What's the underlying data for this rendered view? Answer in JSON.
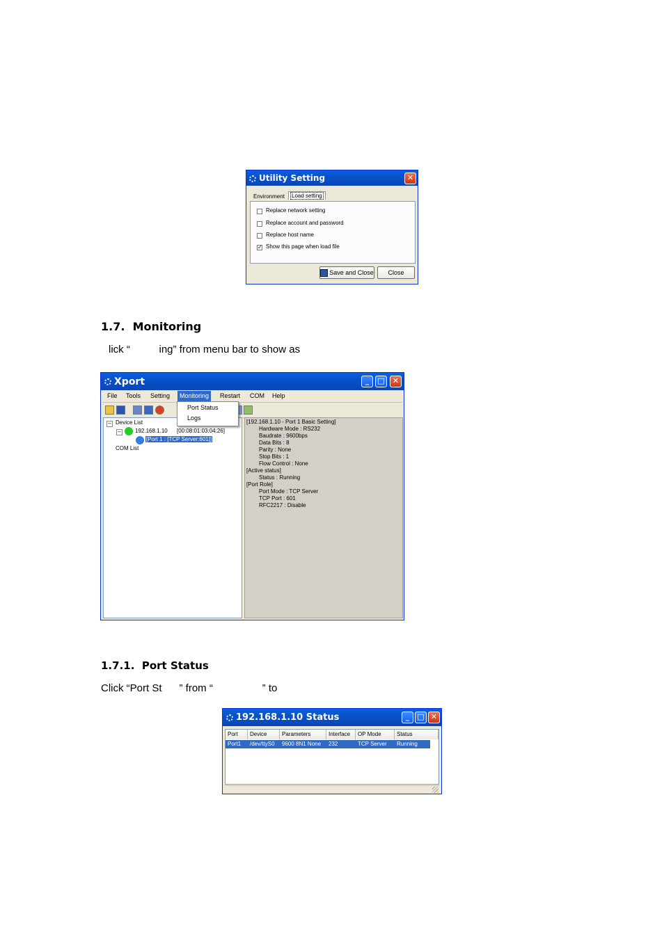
{
  "utility": {
    "title": "Utility Setting",
    "tabs": [
      "Environment",
      "Load setting"
    ],
    "options": [
      {
        "label": "Replace network setting",
        "checked": false
      },
      {
        "label": "Replace account and password",
        "checked": false
      },
      {
        "label": "Replace host name",
        "checked": false
      },
      {
        "label": "Show this page when load file",
        "checked": true
      }
    ],
    "save_label": "Save and Close",
    "close_label": "Close"
  },
  "section_monitoring": {
    "heading": "1.7.  Monitoring",
    "text": "lick “          ing” from menu bar to show as"
  },
  "xport": {
    "title": "Xport",
    "menu": [
      "File",
      "Tools",
      "Setting",
      "Monitoring",
      "Restart",
      "COM",
      "Help"
    ],
    "dropdown": [
      "Port Status",
      "Logs"
    ],
    "tree": {
      "device_list": "Device List",
      "device_ip": "192.168.1.10",
      "device_mac": "[00:08:01:03:04:26]",
      "port": "[Port 1 : [TCP Server:601]]",
      "com_list": "COM List"
    },
    "details": [
      "[192.168.1.10 - Port 1 Basic Setting]",
      "Hardware Mode : RS232",
      "Baudrate : 9600bps",
      "Data Bits : 8",
      "Parity : None",
      "Stop Bits : 1",
      "Flow Control : None",
      "[Active status]",
      "Status : Running",
      "[Port Role]",
      "Port Mode : TCP Server",
      "TCP Port : 601",
      "RFC2217 : Disable"
    ],
    "colors": {
      "title_bar": "#0a5fe0",
      "selection": "#316ac5",
      "online": "#22cc22",
      "port": "#2f7de1"
    }
  },
  "section_port_status": {
    "heading": "1.7.1.  Port Status",
    "text": "Click “Port St      ” from “                 ” to"
  },
  "status_window": {
    "title": "192.168.1.10 Status",
    "columns": [
      "Port",
      "Device",
      "Parameters",
      "Interface",
      "OP Mode",
      "Status"
    ],
    "rows": [
      [
        "Port1",
        "/dev/ttyS0",
        "9600 8N1 None",
        "232",
        "TCP Server",
        "Running"
      ]
    ]
  }
}
